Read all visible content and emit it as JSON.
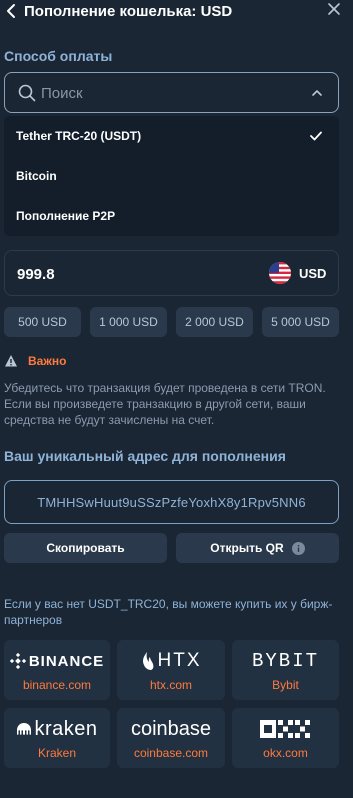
{
  "header": {
    "title": "Пополнение кошелька: USD"
  },
  "payment": {
    "section_label": "Способ оплаты",
    "search_placeholder": "Поиск",
    "options": [
      {
        "label": "Tether TRC-20 (USDT)",
        "selected": true
      },
      {
        "label": "Bitcoin",
        "selected": false
      },
      {
        "label": "Пополнение P2P",
        "selected": false
      }
    ]
  },
  "amount": {
    "value": "999.8",
    "currency": "USD"
  },
  "presets": [
    "500 USD",
    "1 000 USD",
    "2 000 USD",
    "5 000 USD"
  ],
  "warning": {
    "title": "Важно",
    "text": "Убедитесь что транзакция будет проведена в сети TRON. Если вы произведете транзакцию в другой сети, ваши средства не будут зачислены на счет."
  },
  "deposit": {
    "label": "Ваш уникальный адрес для пополнения",
    "address": "TMHHSwHuut9uSSzPzfeYoxhX8y1Rpv5NN6",
    "copy_label": "Скопировать",
    "qr_label": "Открыть QR"
  },
  "buy_note": "Если у вас нет USDT_TRC20, вы можете купить их у бирж-партнеров",
  "exchanges": [
    {
      "logo": "BINANCE",
      "name": "binance.com"
    },
    {
      "logo": "HTX",
      "name": "htx.com"
    },
    {
      "logo": "BYBIT",
      "name": "Bybit"
    },
    {
      "logo": "kraken",
      "name": "Kraken"
    },
    {
      "logo": "coinbase",
      "name": "coinbase.com"
    },
    {
      "logo": "OKX",
      "name": "okx.com"
    }
  ],
  "colors": {
    "background": "#1a2634",
    "accent": "#8fb3d6",
    "warning": "#ff7a3c",
    "button": "#2a3a4c"
  }
}
